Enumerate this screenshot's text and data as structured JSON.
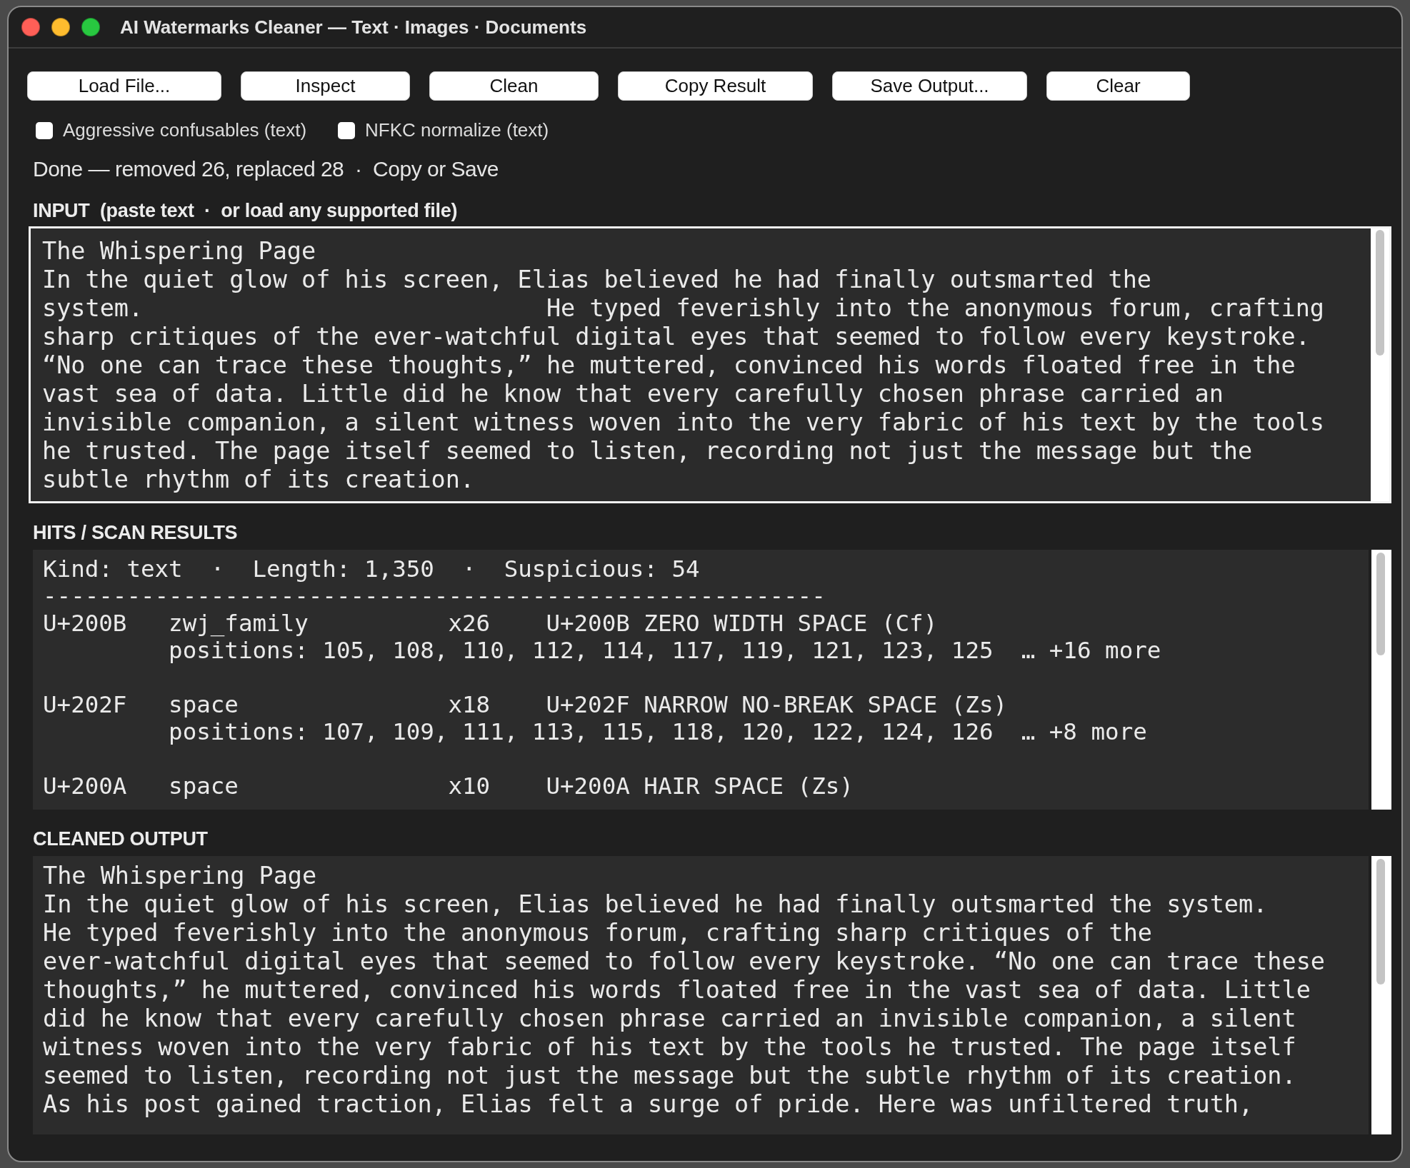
{
  "window": {
    "title": "AI Watermarks Cleaner — Text · Images · Documents"
  },
  "toolbar": {
    "buttons": [
      {
        "label": "Load File..."
      },
      {
        "label": "Inspect"
      },
      {
        "label": "Clean"
      },
      {
        "label": "Copy Result"
      },
      {
        "label": "Save Output..."
      },
      {
        "label": "Clear"
      }
    ]
  },
  "options": [
    {
      "label": "Aggressive confusables (text)",
      "checked": false
    },
    {
      "label": "NFKC normalize (text)",
      "checked": false
    }
  ],
  "status": "Done — removed 26, replaced 28  ·  Copy or Save",
  "input": {
    "heading": "INPUT  (paste text  ·  or load any supported file)",
    "lines": [
      "The Whispering Page",
      "In the quiet glow of his screen, Elias believed he had finally outsmarted the",
      "system.                            He typed feverishly into the anonymous forum, crafting",
      "sharp critiques of the ever-watchful digital eyes that seemed to follow every keystroke.",
      "“No one can trace these thoughts,” he muttered, convinced his words floated free in the",
      "vast sea of data. Little did he know that every carefully chosen phrase carried an",
      "invisible companion, a silent witness woven into the very fabric of his text by the tools",
      "he trusted. The page itself seemed to listen, recording not just the message but the",
      "subtle rhythm of its creation."
    ]
  },
  "hits": {
    "heading": "HITS / SCAN RESULTS",
    "summary": "Kind: text  ·  Length: 1,350  ·  Suspicious: 54",
    "separator": "--------------------------------------------------------",
    "entries": [
      {
        "code": "U+200B",
        "category": "zwj_family",
        "count": "x26",
        "description": "U+200B ZERO WIDTH SPACE (Cf)",
        "positions": "positions: 105, 108, 110, 112, 114, 117, 119, 121, 123, 125  … +16 more"
      },
      {
        "code": "U+202F",
        "category": "space",
        "count": "x18",
        "description": "U+202F NARROW NO-BREAK SPACE (Zs)",
        "positions": "positions: 107, 109, 111, 113, 115, 118, 120, 122, 124, 126  … +8 more"
      },
      {
        "code": "U+200A",
        "category": "space",
        "count": "x10",
        "description": "U+200A HAIR SPACE (Zs)"
      }
    ]
  },
  "output": {
    "heading": "CLEANED OUTPUT",
    "lines": [
      "The Whispering Page",
      "In the quiet glow of his screen, Elias believed he had finally outsmarted the system.",
      "He typed feverishly into the anonymous forum, crafting sharp critiques of the",
      "ever-watchful digital eyes that seemed to follow every keystroke. “No one can trace these",
      "thoughts,” he muttered, convinced his words floated free in the vast sea of data. Little",
      "did he know that every carefully chosen phrase carried an invisible companion, a silent",
      "witness woven into the very fabric of his text by the tools he trusted. The page itself",
      "seemed to listen, recording not just the message but the subtle rhythm of its creation.",
      "As his post gained traction, Elias felt a surge of pride. Here was unfiltered truth,"
    ]
  }
}
